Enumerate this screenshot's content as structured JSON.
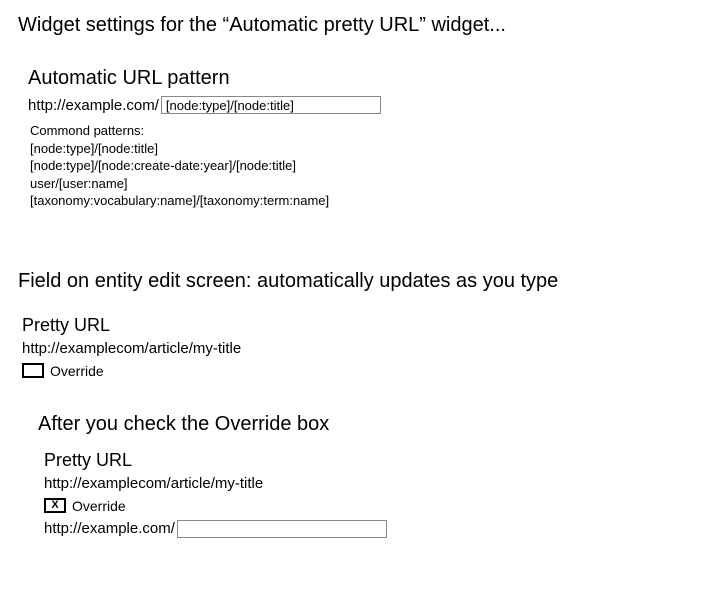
{
  "header": {
    "title": "Widget settings for the “Automatic pretty URL” widget..."
  },
  "settings": {
    "title": "Automatic URL pattern",
    "prefix": "http://example.com/",
    "pattern_value": "[node:type]/[node:title]",
    "hints_title": "Commond patterns:",
    "hints": [
      "[node:type]/[node:title]",
      "[node:type]/[node:create-date:year]/[node:title]",
      "user/[user:name]",
      "[taxonomy:vocabulary:name]/[taxonomy:term:name]"
    ]
  },
  "field": {
    "heading": "Field on entity edit screen: automatically updates as you type",
    "label": "Pretty URL",
    "value": "http://examplecom/article/my-title",
    "override_checked": false,
    "override_label": "Override"
  },
  "after": {
    "heading": "After you check the Override box",
    "label": "Pretty URL",
    "value": "http://examplecom/article/my-title",
    "override_checked_mark": "X",
    "override_label": "Override",
    "input_prefix": "http://example.com/",
    "input_value": ""
  }
}
